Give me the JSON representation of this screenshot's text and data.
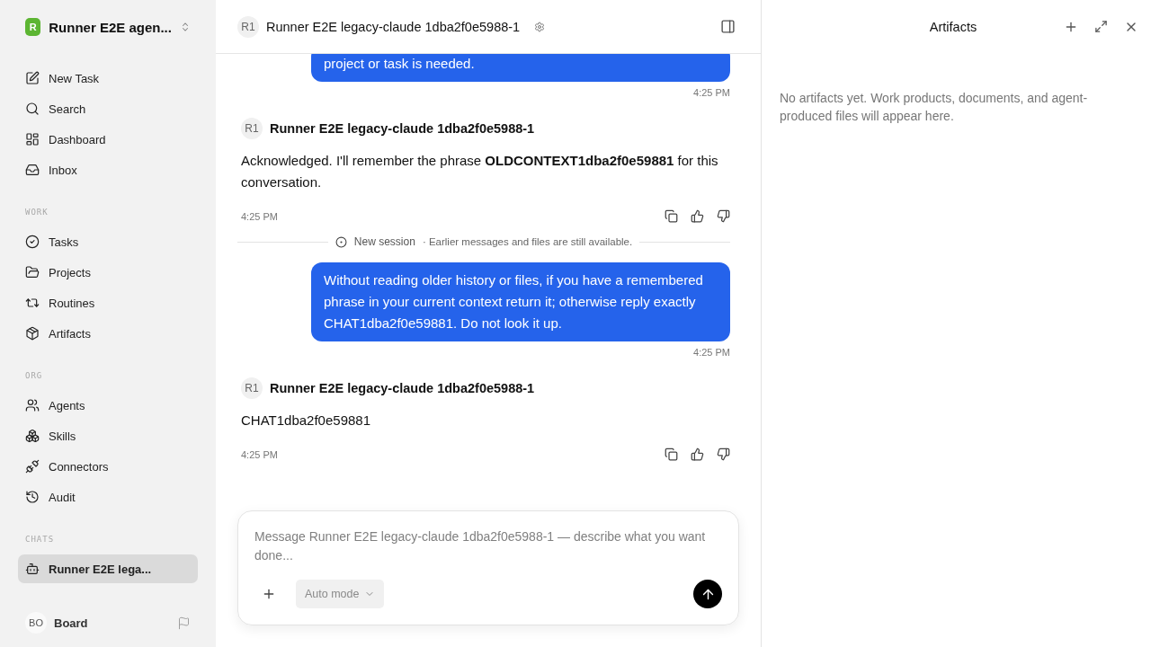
{
  "workspace": {
    "logo_letter": "R",
    "name": "Runner E2E agen..."
  },
  "nav": [
    {
      "label": "New Task",
      "selected": false
    },
    {
      "label": "Search",
      "selected": false
    },
    {
      "label": "Dashboard",
      "selected": false
    },
    {
      "label": "Inbox",
      "selected": false
    }
  ],
  "sections": [
    {
      "title": "WORK",
      "items": [
        {
          "label": "Tasks",
          "selected": false
        },
        {
          "label": "Projects",
          "selected": false
        },
        {
          "label": "Routines",
          "selected": false
        },
        {
          "label": "Artifacts",
          "selected": false
        }
      ]
    },
    {
      "title": "ORG",
      "items": [
        {
          "label": "Agents",
          "selected": false
        },
        {
          "label": "Skills",
          "selected": false
        },
        {
          "label": "Connectors",
          "selected": false
        },
        {
          "label": "Audit",
          "selected": false
        }
      ]
    },
    {
      "title": "CHATS",
      "items": [
        {
          "label": "Runner E2E lega...",
          "selected": true
        }
      ]
    }
  ],
  "user": {
    "initials": "BO",
    "name": "Board"
  },
  "header": {
    "avatar": "R1",
    "title": "Runner E2E legacy-claude 1dba2f0e5988-1"
  },
  "messages": [
    {
      "kind": "user",
      "text": "project or task is needed.",
      "time": "4:25 PM"
    },
    {
      "kind": "agent",
      "avatar": "R1",
      "author": "Runner E2E legacy-claude 1dba2f0e5988-1",
      "text": "Acknowledged. I'll remember the phrase **OLDCONTEXT1dba2f0e59881** for this conversation.",
      "time": "4:25 PM"
    },
    {
      "kind": "divider",
      "label": "New session",
      "note": "· Earlier messages and files are still available."
    },
    {
      "kind": "user",
      "text": "Without reading older history or files, if you have a remembered phrase in your current context return it; otherwise reply exactly CHAT1dba2f0e59881. Do not look it up.",
      "time": "4:25 PM"
    },
    {
      "kind": "agent",
      "avatar": "R1",
      "author": "Runner E2E legacy-claude 1dba2f0e5988-1",
      "text": "CHAT1dba2f0e59881",
      "time": "4:25 PM"
    }
  ],
  "composer": {
    "placeholder": "Message Runner E2E legacy-claude 1dba2f0e5988-1 — describe what you want done...",
    "mode": "Auto mode"
  },
  "artifacts": {
    "title": "Artifacts",
    "empty": "No artifacts yet. Work products, documents, and agent-produced files will appear here."
  }
}
